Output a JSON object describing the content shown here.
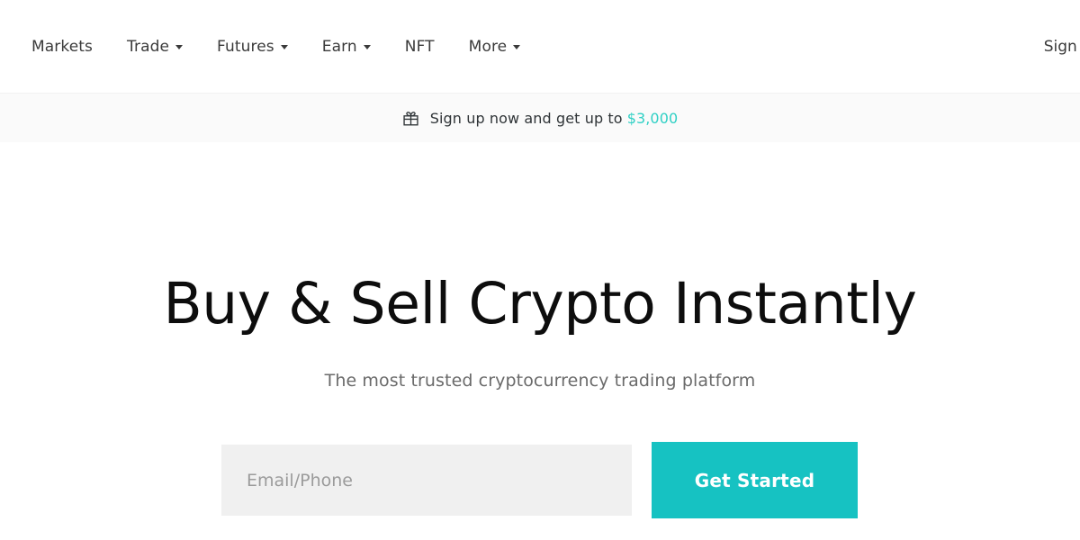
{
  "header": {
    "nav_items": [
      {
        "label": "Markets",
        "has_dropdown": false
      },
      {
        "label": "Trade",
        "has_dropdown": true
      },
      {
        "label": "Futures",
        "has_dropdown": true
      },
      {
        "label": "Earn",
        "has_dropdown": true
      },
      {
        "label": "NFT",
        "has_dropdown": false
      },
      {
        "label": "More",
        "has_dropdown": true
      }
    ],
    "sign_in_label": "Sign In"
  },
  "promo_banner": {
    "icon": "gift-icon",
    "text": "Sign up now and get up to",
    "amount": "$3,000",
    "amount_color": "#2fd0c5",
    "background_color": "#fafafa"
  },
  "hero": {
    "headline": "Buy & Sell Crypto Instantly",
    "subtitle": "The most trusted cryptocurrency trading platform",
    "form": {
      "input_value": "",
      "input_placeholder": "Email/Phone",
      "input_background": "#f0f0f0",
      "button_label": "Get Started",
      "button_color": "#16c2c2"
    }
  }
}
